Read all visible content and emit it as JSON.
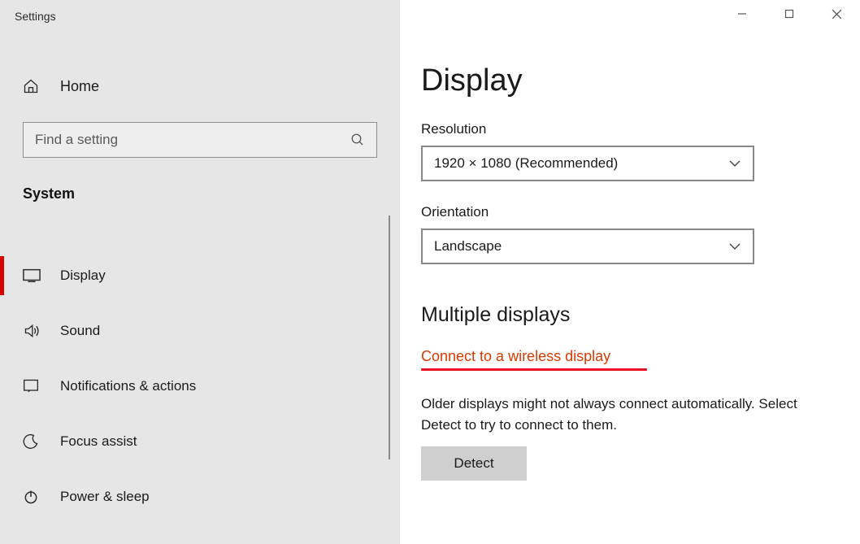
{
  "window": {
    "title": "Settings"
  },
  "sidebar": {
    "home_label": "Home",
    "search_placeholder": "Find a setting",
    "category": "System",
    "items": [
      {
        "label": "Display",
        "icon": "display-icon",
        "active": true
      },
      {
        "label": "Sound",
        "icon": "sound-icon",
        "active": false
      },
      {
        "label": "Notifications & actions",
        "icon": "notifications-icon",
        "active": false
      },
      {
        "label": "Focus assist",
        "icon": "moon-icon",
        "active": false
      },
      {
        "label": "Power & sleep",
        "icon": "power-icon",
        "active": false
      }
    ]
  },
  "main": {
    "title": "Display",
    "resolution": {
      "label": "Resolution",
      "value": "1920 × 1080 (Recommended)"
    },
    "orientation": {
      "label": "Orientation",
      "value": "Landscape"
    },
    "multiple_displays": {
      "heading": "Multiple displays",
      "connect_link": "Connect to a wireless display",
      "help_text": "Older displays might not always connect automatically. Select Detect to try to connect to them.",
      "detect_button": "Detect"
    }
  }
}
